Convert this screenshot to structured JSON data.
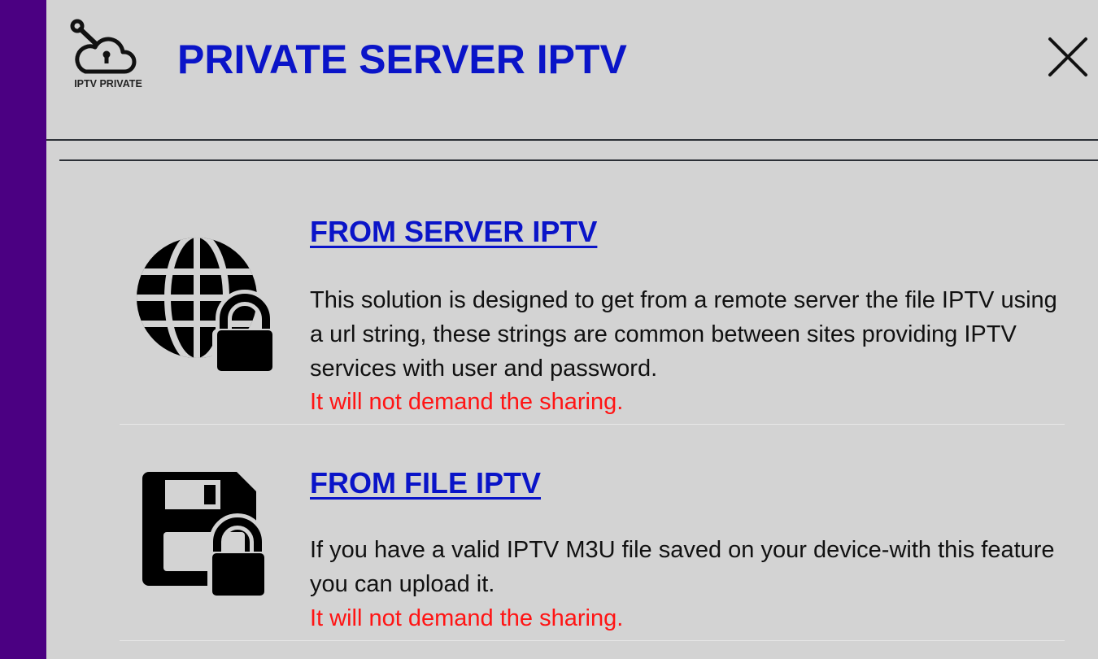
{
  "header": {
    "logo_caption": "IPTV PRIVATE",
    "title": "PRIVATE SERVER IPTV",
    "close_icon": "close-icon"
  },
  "options": [
    {
      "icon": "globe-lock-icon",
      "title": "FROM SERVER IPTV",
      "description": "This solution is designed to get from a remote server the file IPTV using a url string, these strings are common between sites providing IPTV services with user and password.",
      "note": "It will not demand the sharing."
    },
    {
      "icon": "floppy-lock-icon",
      "title": "FROM FILE IPTV",
      "description": "If you have a valid IPTV M3U file saved on your device-with this feature you can upload it.",
      "note": "It will not demand the sharing."
    }
  ],
  "colors": {
    "side_strip": "#4b0082",
    "background": "#d3d3d3",
    "title_blue": "#0a14c8",
    "note_red": "#ff1414"
  }
}
